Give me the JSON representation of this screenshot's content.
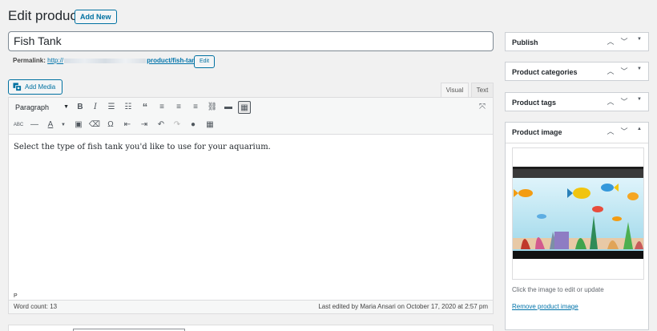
{
  "header": {
    "title": "Edit product",
    "add_new": "Add New"
  },
  "post": {
    "title": "Fish Tank",
    "permalink_label": "Permalink:",
    "permalink_prefix": "http://",
    "permalink_path": "product/fish-tank/",
    "edit_button": "Edit"
  },
  "editor": {
    "add_media": "Add Media",
    "tabs": {
      "visual": "Visual",
      "text": "Text"
    },
    "format_select": "Paragraph",
    "content": "Select the type of fish tank you'd like to use for your aquarium.",
    "path": "P",
    "word_count": "Word count: 13",
    "last_edited": "Last edited by Maria Ansari on October 17, 2020 at 2:57 pm"
  },
  "sidebar": {
    "publish": "Publish",
    "categories": "Product categories",
    "tags": "Product tags",
    "image": "Product image",
    "image_note": "Click the image to edit or update",
    "remove_image": "Remove product image"
  }
}
